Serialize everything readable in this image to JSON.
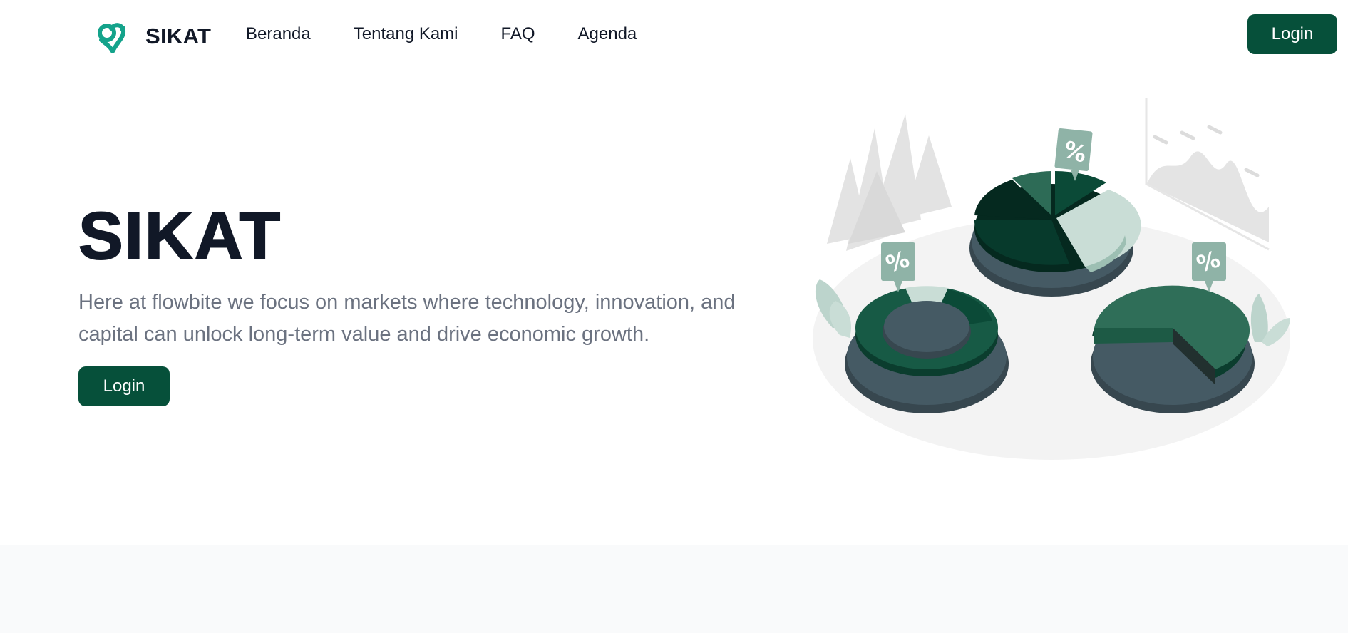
{
  "brand": {
    "name": "SIKAT",
    "logo_icon": "heart-location-logo-icon",
    "logo_color": "#14a38b"
  },
  "nav": {
    "links": [
      {
        "label": "Beranda"
      },
      {
        "label": "Tentang Kami"
      },
      {
        "label": "FAQ"
      },
      {
        "label": "Agenda"
      }
    ],
    "login_label": "Login"
  },
  "hero": {
    "title": "SIKAT",
    "description": "Here at flowbite we focus on markets where technology, innovation, and capital can unlock long-term value and drive economic growth.",
    "login_label": "Login",
    "illustration_icon": "pie-charts-illustration-icon"
  },
  "colors": {
    "primary": "#06503a",
    "title": "#111827",
    "muted": "#6b7280",
    "band": "#f9fafb"
  }
}
